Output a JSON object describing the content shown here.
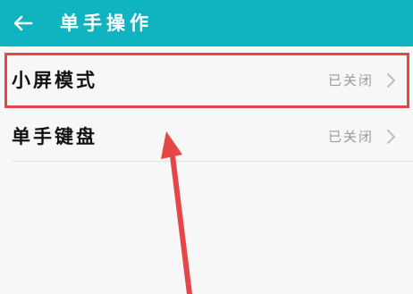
{
  "header": {
    "title": "单手操作",
    "back_icon": "back-arrow-icon"
  },
  "settings": [
    {
      "label": "小屏模式",
      "value": "已关闭",
      "icon": "chevron-right-icon"
    },
    {
      "label": "单手键盘",
      "value": "已关闭",
      "icon": "chevron-right-icon"
    }
  ],
  "colors": {
    "header": "#10b4c1",
    "highlight": "#e54646",
    "annotation_arrow": "#e54646",
    "background": "#f7f7f7"
  }
}
